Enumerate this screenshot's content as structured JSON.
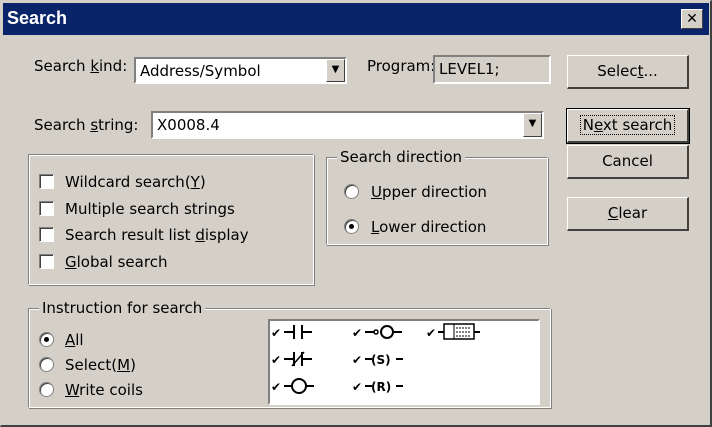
{
  "window": {
    "title": "Search"
  },
  "search_kind": {
    "label_pre": "Search ",
    "label_ul": "k",
    "label_post": "ind:",
    "value": "Address/Symbol"
  },
  "program": {
    "label": "Program:",
    "value": "LEVEL1;"
  },
  "search_string": {
    "label_pre": "Search ",
    "label_ul": "s",
    "label_post": "tring:",
    "value": "X0008.4"
  },
  "buttons": {
    "select": {
      "pre": "Selec",
      "ul": "t",
      "post": "..."
    },
    "next_search": {
      "pre": "N",
      "ul": "e",
      "post": "xt search"
    },
    "cancel": "Cancel",
    "clear": {
      "pre": "",
      "ul": "C",
      "post": "lear"
    }
  },
  "options": [
    {
      "pre": "Wildcard search(",
      "ul": "Y",
      "post": ")",
      "checked": false
    },
    {
      "pre": "Multiple search strings",
      "ul": "",
      "post": "",
      "checked": false
    },
    {
      "pre": "Search result list ",
      "ul": "d",
      "post": "isplay",
      "checked": false
    },
    {
      "pre": "",
      "ul": "G",
      "post": "lobal search",
      "checked": false
    }
  ],
  "direction": {
    "legend": "Search direction",
    "upper": {
      "pre": "",
      "ul": "U",
      "post": "pper direction",
      "selected": false
    },
    "lower": {
      "pre": "",
      "ul": "L",
      "post": "ower direction",
      "selected": true
    }
  },
  "instruction": {
    "legend": "Instruction for search",
    "all": {
      "pre": "",
      "ul": "A",
      "post": "ll",
      "selected": true
    },
    "select": {
      "pre": "Select(",
      "ul": "M",
      "post": ")",
      "selected": false
    },
    "write_coils": {
      "pre": "",
      "ul": "W",
      "post": "rite coils",
      "selected": false
    },
    "ladder_items": [
      "a-contact",
      "coil",
      "function-block",
      "b-contact",
      "set-coil",
      "negated-coil",
      "reset-coil"
    ],
    "coil_set_text": "(S)",
    "coil_reset_text": "(R)",
    "check_mark": "✔"
  }
}
